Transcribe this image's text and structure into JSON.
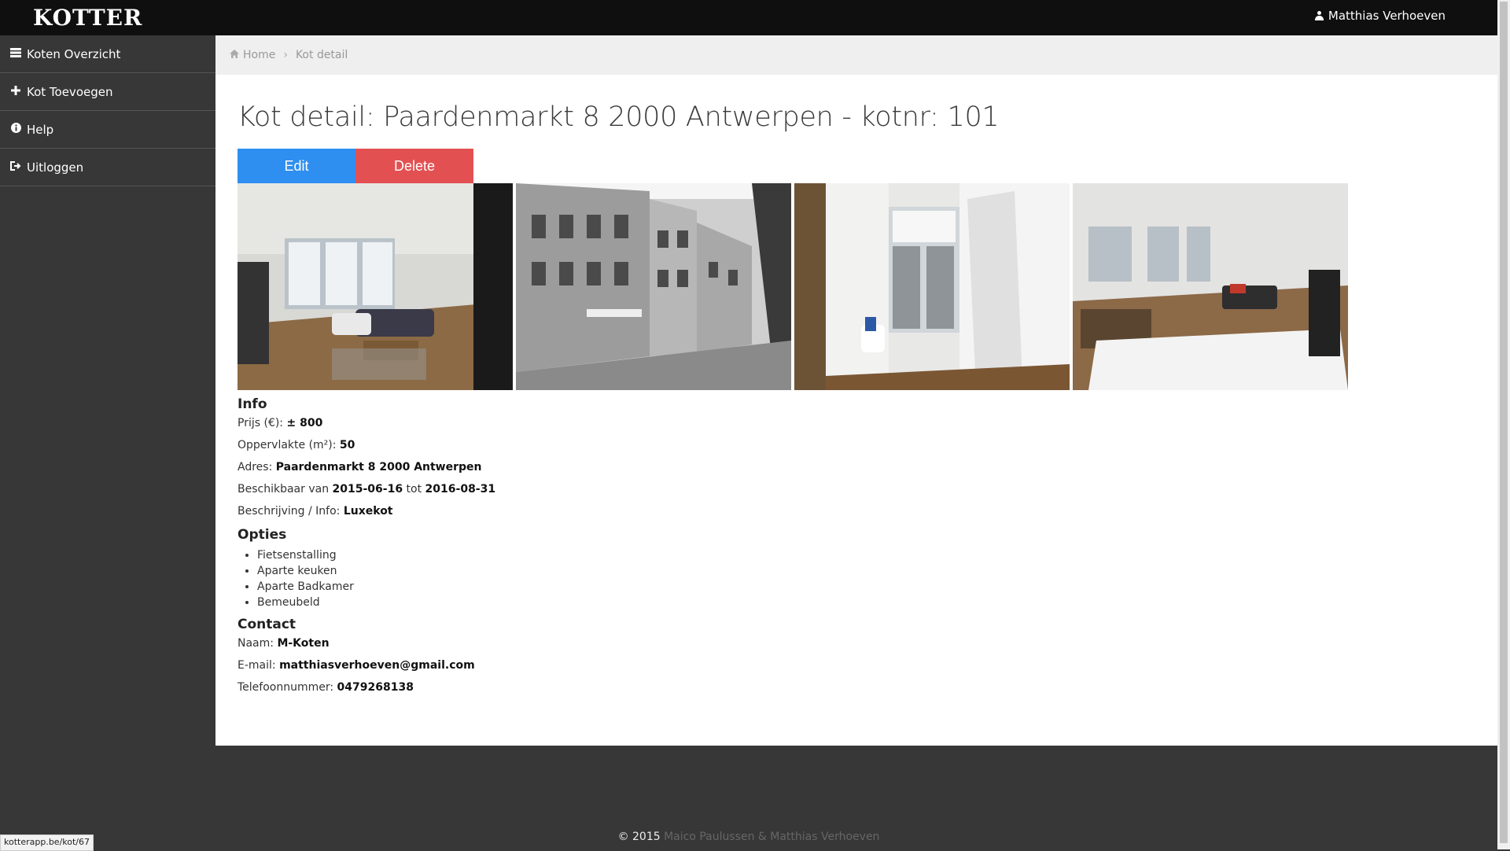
{
  "app": {
    "brand": "KOTTER",
    "user": "Matthias Verhoeven"
  },
  "sidebar": {
    "items": [
      {
        "label": "Koten Overzicht",
        "icon": "list-icon"
      },
      {
        "label": "Kot Toevoegen",
        "icon": "plus-icon"
      },
      {
        "label": "Help",
        "icon": "info-icon"
      },
      {
        "label": "Uitloggen",
        "icon": "logout-icon"
      }
    ]
  },
  "breadcrumb": {
    "home": "Home",
    "current": "Kot detail"
  },
  "page": {
    "title": "Kot detail: Paardenmarkt 8 2000 Antwerpen - kotnr: 101"
  },
  "actions": {
    "edit": "Edit",
    "delete": "Delete"
  },
  "info": {
    "heading": "Info",
    "prijs_label": "Prijs (€): ",
    "prijs_value": "± 800",
    "oppervlakte_label": "Oppervlakte (m²): ",
    "oppervlakte_value": "50",
    "adres_label": "Adres: ",
    "adres_value": "Paardenmarkt 8 2000 Antwerpen",
    "beschikbaar_label": "Beschikbaar van ",
    "beschikbaar_van": "2015-06-16",
    "tot_label": " tot ",
    "beschikbaar_tot": "2016-08-31",
    "beschrijving_label": "Beschrijving / Info: ",
    "beschrijving_value": "Luxekot"
  },
  "opties": {
    "heading": "Opties",
    "items": [
      "Fietsenstalling",
      "Aparte keuken",
      "Aparte Badkamer",
      "Bemeubeld"
    ]
  },
  "contact": {
    "heading": "Contact",
    "naam_label": "Naam: ",
    "naam_value": "M-Koten",
    "email_label": "E-mail: ",
    "email_value": "matthiasverhoeven@gmail.com",
    "tel_label": "Telefoonnummer: ",
    "tel_value": "0479268138"
  },
  "footer": {
    "copyright": "© 2015 ",
    "authors": "Maico Paulussen & Matthias Verhoeven"
  },
  "statusbar": {
    "url": "kotterapp.be/kot/67"
  },
  "colors": {
    "edit": "#2f8ff0",
    "delete": "#e35052",
    "sidebar": "#373737",
    "topbar": "#0f0f0f"
  }
}
